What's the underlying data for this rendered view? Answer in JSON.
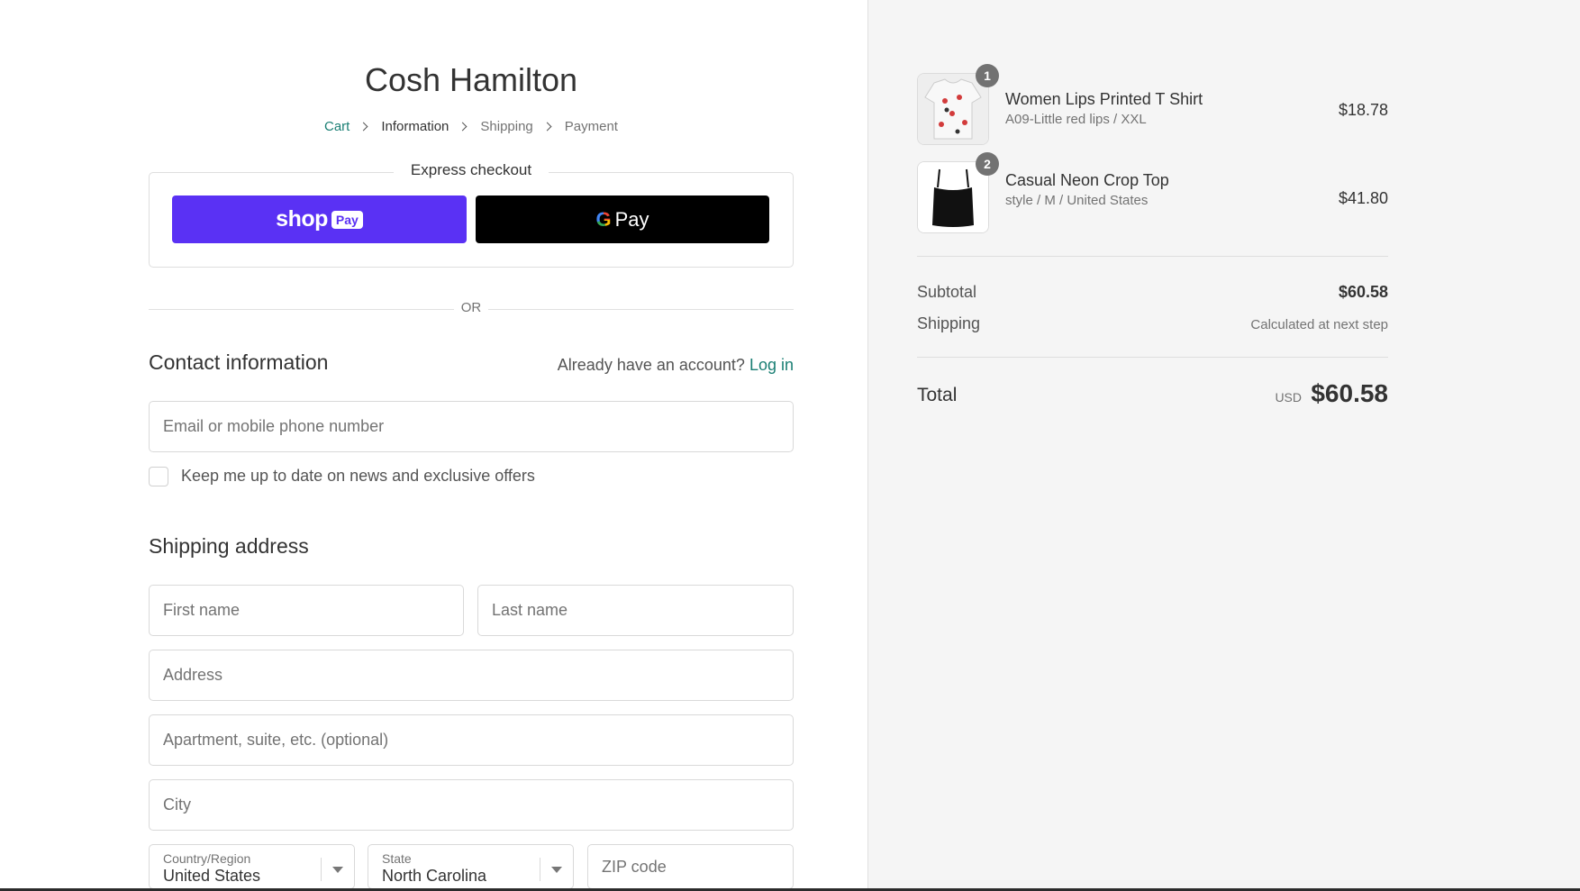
{
  "store": {
    "name": "Cosh Hamilton"
  },
  "breadcrumb": {
    "items": [
      "Cart",
      "Information",
      "Shipping",
      "Payment"
    ]
  },
  "express": {
    "title": "Express checkout",
    "shop_pay": {
      "word": "shop",
      "pill": "Pay"
    },
    "google_pay": {
      "letter": "G",
      "word": "Pay"
    }
  },
  "divider": {
    "or": "OR"
  },
  "contact": {
    "heading": "Contact information",
    "account_prompt": "Already have an account?",
    "login_link": "Log in",
    "email_placeholder": "Email or mobile phone number",
    "newsletter_label": "Keep me up to date on news and exclusive offers"
  },
  "shipping": {
    "heading": "Shipping address",
    "first_name_placeholder": "First name",
    "last_name_placeholder": "Last name",
    "address_placeholder": "Address",
    "apartment_placeholder": "Apartment, suite, etc. (optional)",
    "city_placeholder": "City",
    "country": {
      "label": "Country/Region",
      "value": "United States"
    },
    "state": {
      "label": "State",
      "value": "North Carolina"
    },
    "zip_placeholder": "ZIP code"
  },
  "order": {
    "items": [
      {
        "quantity": "1",
        "name": "Women Lips Printed T Shirt",
        "variant": "A09-Little red lips / XXL",
        "price": "$18.78"
      },
      {
        "quantity": "2",
        "name": "Casual Neon Crop Top",
        "variant": "style / M / United States",
        "price": "$41.80"
      }
    ],
    "subtotal_label": "Subtotal",
    "subtotal_value": "$60.58",
    "shipping_label": "Shipping",
    "shipping_value": "Calculated at next step",
    "total_label": "Total",
    "total_currency": "USD",
    "total_value": "$60.58"
  },
  "colors": {
    "accent_link": "#1a7f74",
    "shop_pay": "#5a31f4",
    "google_pay": "#000000",
    "sidebar_bg": "#f5f5f5"
  }
}
